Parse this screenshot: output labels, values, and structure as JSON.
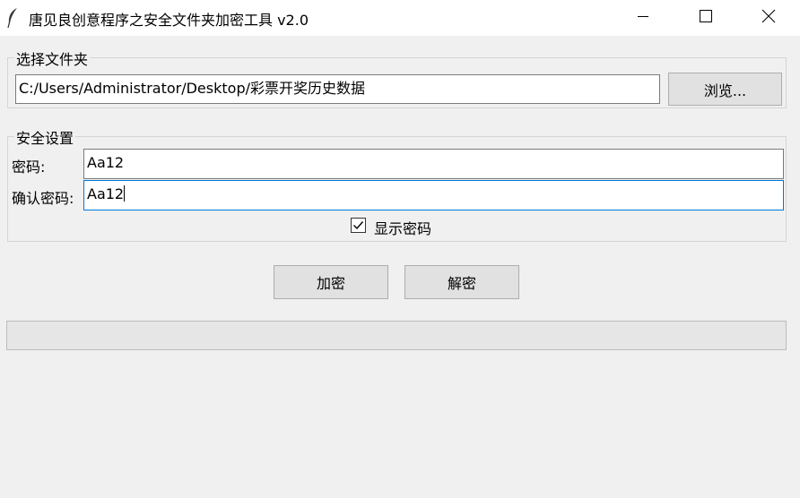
{
  "window": {
    "title": "唐见良创意程序之安全文件夹加密工具 v2.0"
  },
  "folder_group": {
    "label": "选择文件夹",
    "path_value": "C:/Users/Administrator/Desktop/彩票开奖历史数据",
    "browse_label": "浏览..."
  },
  "security_group": {
    "label": "安全设置",
    "password_label": "密码:",
    "password_value": "Aa12",
    "confirm_label": "确认密码:",
    "confirm_value": "Aa12",
    "show_password_label": "显示密码",
    "show_password_checked": true
  },
  "actions": {
    "encrypt_label": "加密",
    "decrypt_label": "解密"
  },
  "progress": {
    "value": 0
  },
  "icons": {
    "app": "feather-icon",
    "minimize": "minimize-icon",
    "maximize": "maximize-icon",
    "close": "close-icon",
    "checkbox": "checkmark-icon"
  },
  "colors": {
    "focus_border": "#0078d7",
    "window_bg": "#f0f0f0",
    "button_bg": "#e1e1e1"
  }
}
